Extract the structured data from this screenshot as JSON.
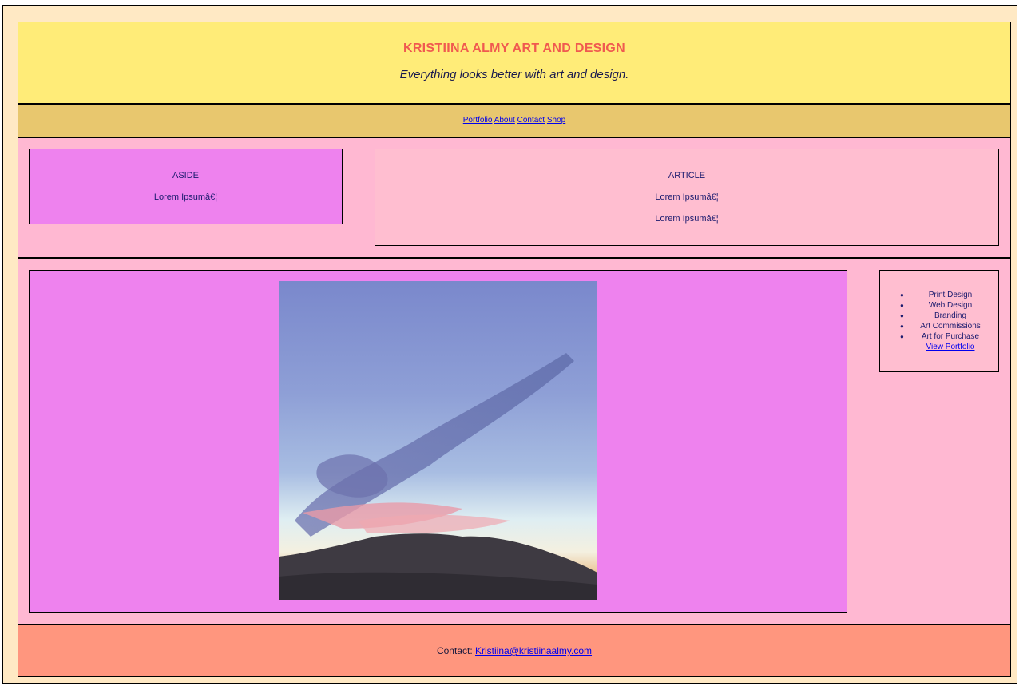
{
  "header": {
    "title": "KRISTIINA ALMY ART AND DESIGN",
    "tagline": "Everything looks better with art and design."
  },
  "nav": {
    "items": [
      {
        "label": "Portfolio"
      },
      {
        "label": "About"
      },
      {
        "label": "Contact"
      },
      {
        "label": "Shop"
      }
    ]
  },
  "aside": {
    "heading": "ASIDE",
    "text": "Lorem Ipsumâ€¦"
  },
  "article": {
    "heading": "ARTICLE",
    "paragraphs": [
      "Lorem Ipsumâ€¦",
      "Lorem Ipsumâ€¦"
    ]
  },
  "gallery": {
    "image": "sunset-painting"
  },
  "services": {
    "items": [
      "Print Design",
      "Web Design",
      "Branding",
      "Art Commissions",
      "Art for Purchase"
    ],
    "link_label": "View Portfolio"
  },
  "footer": {
    "label": "Contact:",
    "email": "Kristiina@kristiinaalmy.com"
  },
  "colors": {
    "page_bg": "#ffe9c4",
    "header_bg": "#ffec78",
    "nav_bg": "#e8c76e",
    "body_bg": "#ffb8d2",
    "violet": "#ee82ee",
    "footer_bg": "#ff967e",
    "title": "#f05a50"
  }
}
